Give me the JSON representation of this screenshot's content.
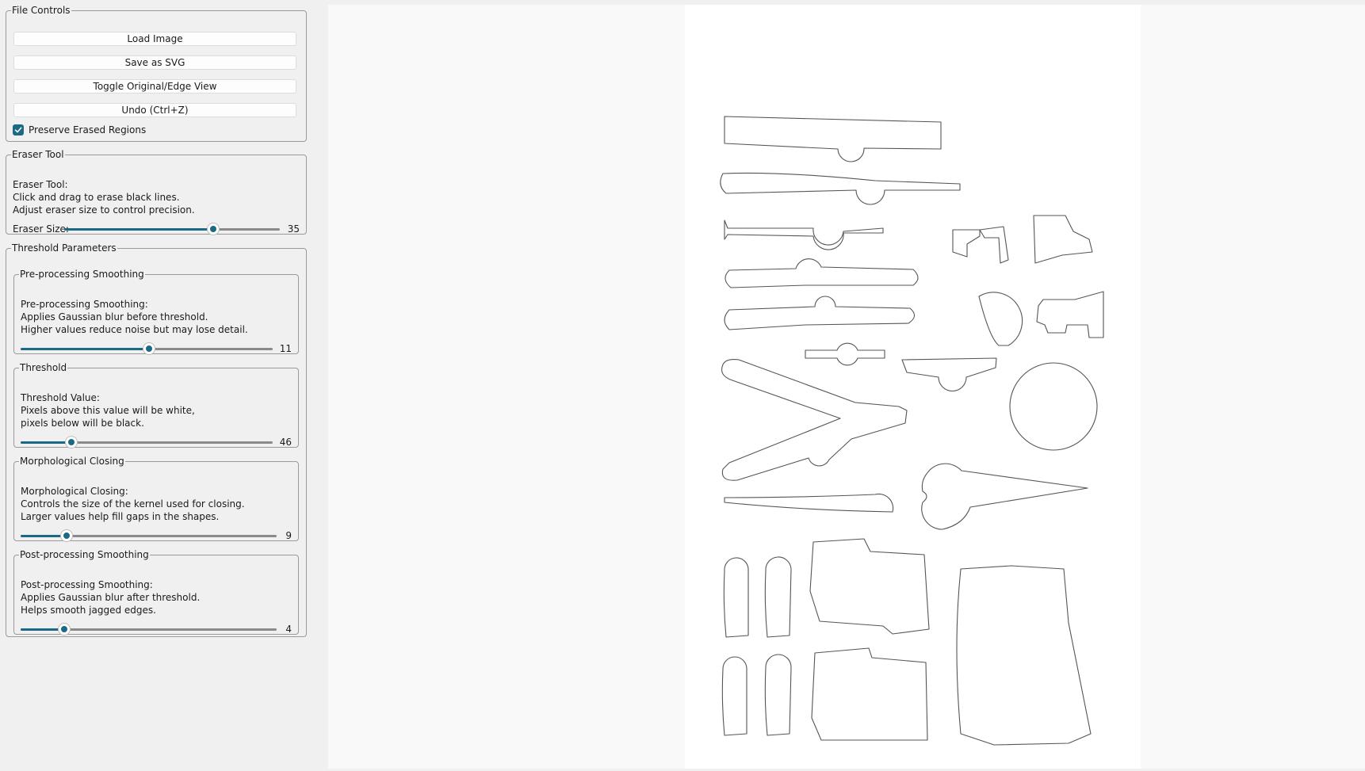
{
  "file_controls": {
    "title": "File Controls",
    "load_label": "Load Image",
    "save_label": "Save as SVG",
    "toggle_label": "Toggle Original/Edge View",
    "undo_label": "Undo (Ctrl+Z)",
    "preserve_label": "Preserve Erased Regions",
    "preserve_checked": true
  },
  "eraser": {
    "title": "Eraser Tool",
    "desc": [
      "Eraser Tool:",
      "Click and drag to erase black lines.",
      "Adjust eraser size to control precision."
    ],
    "size_label": "Eraser Size:",
    "size_value": "35",
    "size_fraction": 0.69
  },
  "threshold_params": {
    "title": "Threshold Parameters",
    "pre": {
      "title": "Pre-processing Smoothing",
      "desc": [
        "Pre-processing Smoothing:",
        "Applies Gaussian blur before threshold.",
        "Higher values reduce noise but may lose detail."
      ],
      "value": "11",
      "fraction": 0.51
    },
    "threshold": {
      "title": "Threshold",
      "desc": [
        "Threshold Value:",
        "Pixels above this value will be white,",
        "pixels below will be black."
      ],
      "value": "46",
      "fraction": 0.2
    },
    "morph": {
      "title": "Morphological Closing",
      "desc": [
        "Morphological Closing:",
        "Controls the size of the kernel used for closing.",
        "Larger values help fill gaps in the shapes."
      ],
      "value": "9",
      "fraction": 0.18
    },
    "post": {
      "title": "Post-processing Smoothing",
      "desc": [
        "Post-processing Smoothing:",
        "Applies Gaussian blur after threshold.",
        "Helps smooth jagged edges."
      ],
      "value": "4",
      "fraction": 0.17
    }
  },
  "colors": {
    "accent": "#1b6a85",
    "panel_bg": "#f0f0f0",
    "canvas_bg": "#ffffff",
    "outline": "#555555"
  },
  "canvas": {
    "content": "edge-outline view of traced tool shapes",
    "preview_shapes": [
      "long-bar",
      "rod",
      "pin",
      "handle",
      "handle",
      "clip",
      "clamp",
      "pliers",
      "disc",
      "bracket",
      "rod",
      "bracket",
      "disc",
      "long-pin",
      "spike",
      "block",
      "block",
      "block",
      "block",
      "case",
      "case",
      "case"
    ]
  }
}
